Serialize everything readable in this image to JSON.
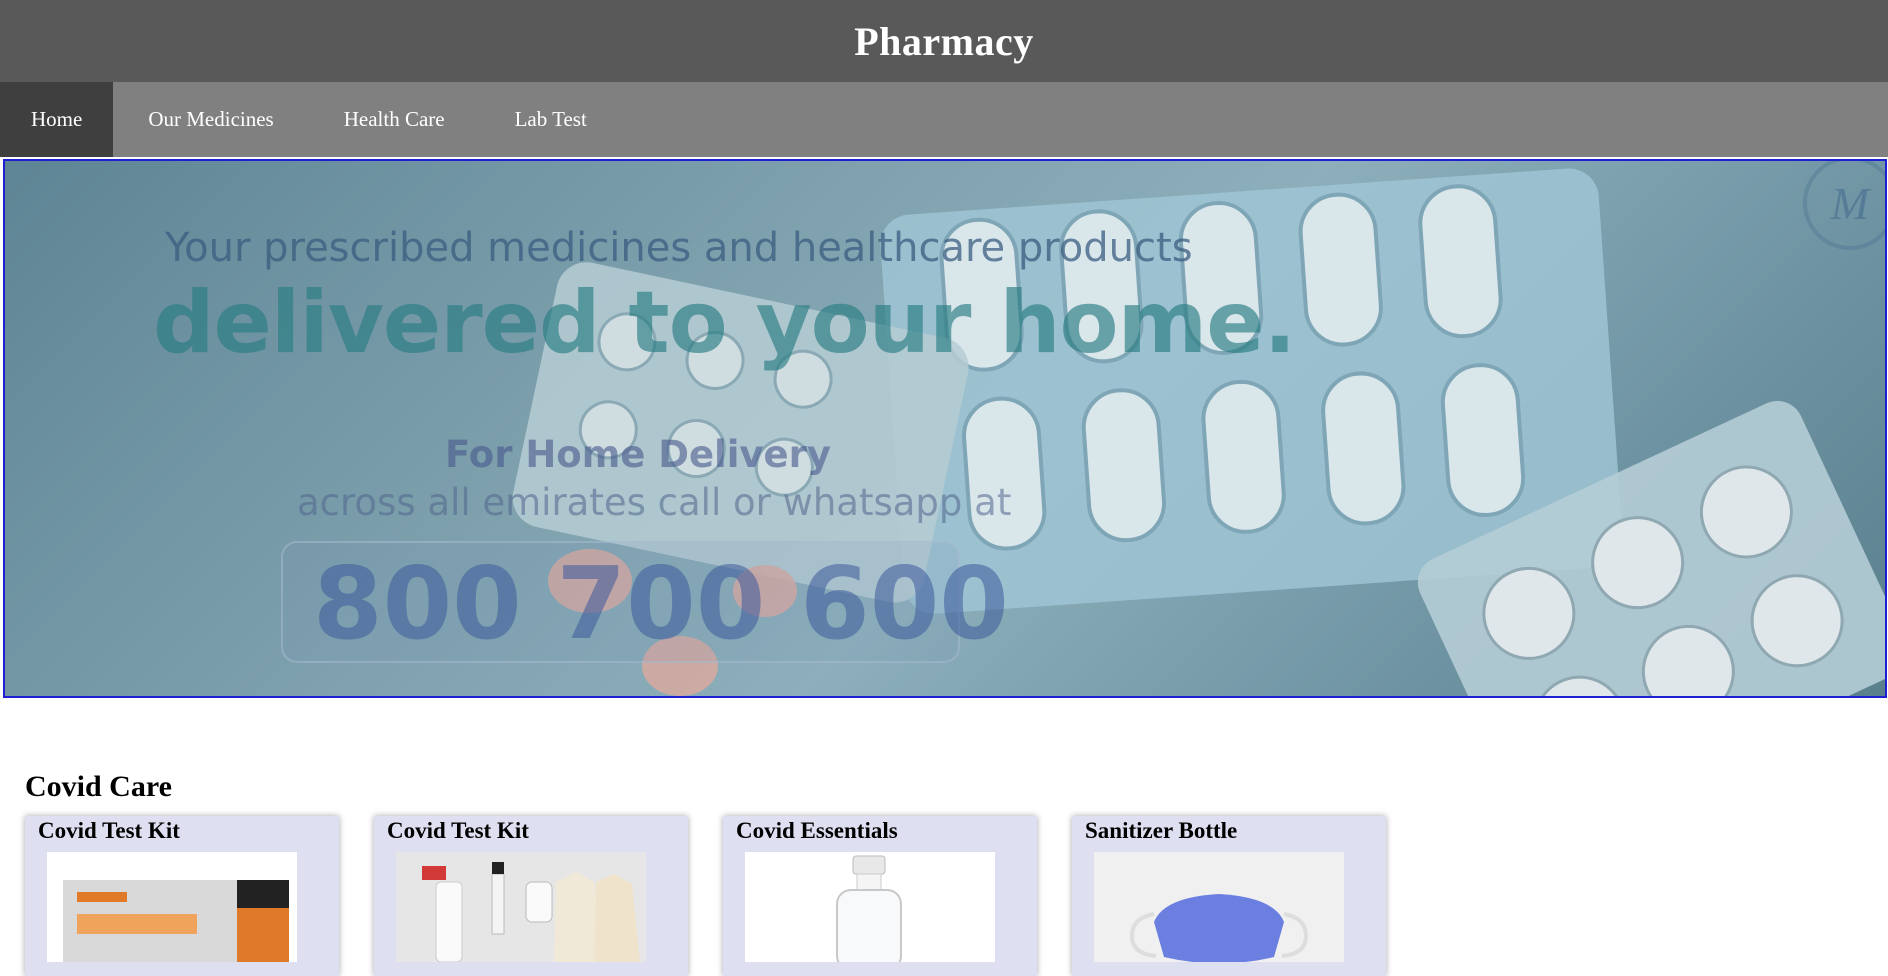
{
  "header": {
    "title": "Pharmacy"
  },
  "nav": {
    "items": [
      {
        "label": "Home",
        "active": true
      },
      {
        "label": "Our Medicines",
        "active": false
      },
      {
        "label": "Health Care",
        "active": false
      },
      {
        "label": "Lab Test",
        "active": false
      }
    ]
  },
  "banner": {
    "line1": "Your prescribed medicines and healthcare products",
    "line2": "delivered to your home.",
    "line3": "For Home Delivery",
    "line4": "across all emirates call or whatsapp at",
    "phone": "800 700 600"
  },
  "covid_section": {
    "title": "Covid Care",
    "cards": [
      {
        "title": "Covid Test Kit",
        "image": "coviself-test-kit-box"
      },
      {
        "title": "Covid Test Kit",
        "image": "spray-bottle-gloves-kit"
      },
      {
        "title": "Covid Essentials",
        "image": "spray-bottle"
      },
      {
        "title": "Sanitizer Bottle",
        "image": "blue-face-mask"
      }
    ]
  },
  "colors": {
    "header_bg": "#595959",
    "nav_bg": "#808080",
    "nav_active_bg": "#3f3f3f",
    "card_bg": "#dedff0",
    "hero_border": "#1e1ed2"
  }
}
